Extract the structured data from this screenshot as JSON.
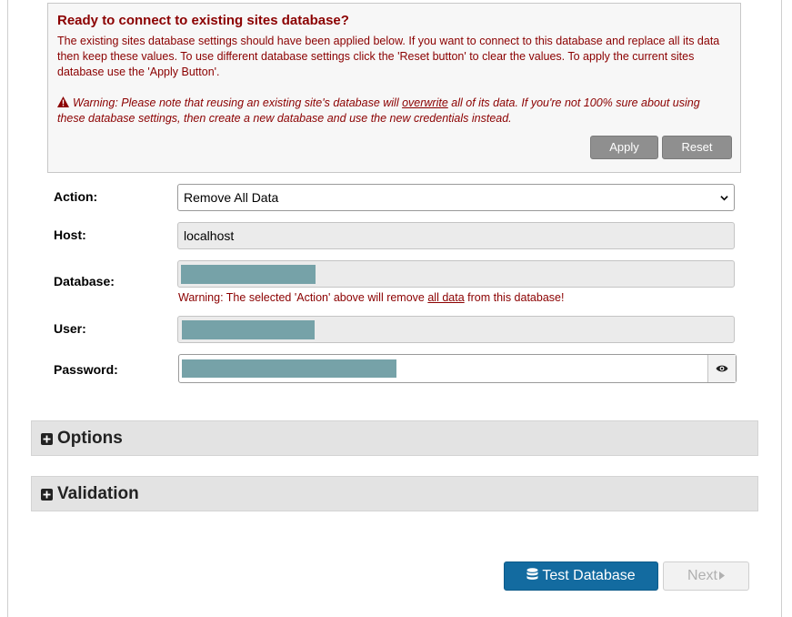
{
  "notice": {
    "title": "Ready to connect to existing sites database?",
    "body": "The existing sites database settings should have been applied below. If you want to connect to this database and replace all its data then keep these values. To use different database settings click the 'Reset button' to clear the values. To apply the current sites database use the 'Apply Button'.",
    "warning_prefix": "Warning: Please note that reusing an existing site's database will ",
    "warning_emph": "overwrite",
    "warning_suffix": " all of its data. If you're not 100% sure about using these database settings, then create a new database and use the new credentials instead.",
    "apply_label": "Apply",
    "reset_label": "Reset"
  },
  "form": {
    "action_label": "Action:",
    "action_value": "Remove All Data",
    "host_label": "Host:",
    "host_value": "localhost",
    "database_label": "Database:",
    "database_warning_prefix": "Warning: The selected 'Action' above will remove ",
    "database_warning_emph": "all data",
    "database_warning_suffix": " from this database!",
    "user_label": "User:",
    "password_label": "Password:"
  },
  "sections": {
    "options_label": "Options",
    "validation_label": "Validation"
  },
  "buttons": {
    "test_database_label": "Test Database",
    "next_label": "Next"
  },
  "colors": {
    "warning_text": "#8b0000",
    "primary_button": "#136ba0",
    "redaction": "#76a2a8"
  }
}
